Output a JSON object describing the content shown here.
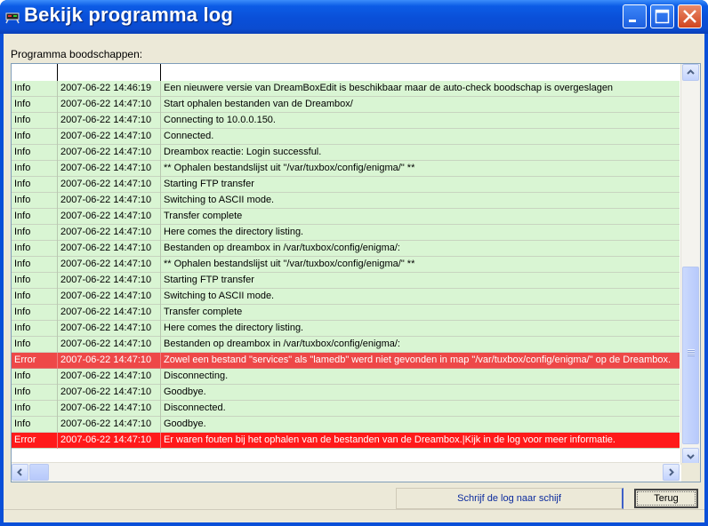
{
  "window": {
    "title": "Bekijk programma log"
  },
  "labels": {
    "messages": "Programma boodschappen:"
  },
  "log": {
    "rows": [
      {
        "type": "Info",
        "time": "2007-06-22 14:46:19",
        "message": "Een nieuwere versie van DreamBoxEdit is beschikbaar maar de auto-check boodschap is overgeslagen"
      },
      {
        "type": "Info",
        "time": "2007-06-22 14:47:10",
        "message": "Start ophalen bestanden van de Dreambox/"
      },
      {
        "type": "Info",
        "time": "2007-06-22 14:47:10",
        "message": "Connecting to 10.0.0.150."
      },
      {
        "type": "Info",
        "time": "2007-06-22 14:47:10",
        "message": "Connected."
      },
      {
        "type": "Info",
        "time": "2007-06-22 14:47:10",
        "message": "Dreambox reactie: Login successful."
      },
      {
        "type": "Info",
        "time": "2007-06-22 14:47:10",
        "message": "** Ophalen bestandslijst uit \"/var/tuxbox/config/enigma/\" **"
      },
      {
        "type": "Info",
        "time": "2007-06-22 14:47:10",
        "message": "Starting FTP transfer"
      },
      {
        "type": "Info",
        "time": "2007-06-22 14:47:10",
        "message": "Switching to ASCII mode."
      },
      {
        "type": "Info",
        "time": "2007-06-22 14:47:10",
        "message": "Transfer complete"
      },
      {
        "type": "Info",
        "time": "2007-06-22 14:47:10",
        "message": "Here comes the directory listing."
      },
      {
        "type": "Info",
        "time": "2007-06-22 14:47:10",
        "message": "Bestanden op dreambox in /var/tuxbox/config/enigma/:"
      },
      {
        "type": "Info",
        "time": "2007-06-22 14:47:10",
        "message": "** Ophalen bestandslijst uit \"/var/tuxbox/config/enigma/\" **"
      },
      {
        "type": "Info",
        "time": "2007-06-22 14:47:10",
        "message": "Starting FTP transfer"
      },
      {
        "type": "Info",
        "time": "2007-06-22 14:47:10",
        "message": "Switching to ASCII mode."
      },
      {
        "type": "Info",
        "time": "2007-06-22 14:47:10",
        "message": "Transfer complete"
      },
      {
        "type": "Info",
        "time": "2007-06-22 14:47:10",
        "message": "Here comes the directory listing."
      },
      {
        "type": "Info",
        "time": "2007-06-22 14:47:10",
        "message": "Bestanden op dreambox in /var/tuxbox/config/enigma/:"
      },
      {
        "type": "Error",
        "time": "2007-06-22 14:47:10",
        "message": "Zowel een bestand \"services\" als \"lamedb\" werd niet gevonden in map \"/var/tuxbox/config/enigma/\" op de Dreambox."
      },
      {
        "type": "Info",
        "time": "2007-06-22 14:47:10",
        "message": "Disconnecting."
      },
      {
        "type": "Info",
        "time": "2007-06-22 14:47:10",
        "message": "Goodbye."
      },
      {
        "type": "Info",
        "time": "2007-06-22 14:47:10",
        "message": "Disconnected."
      },
      {
        "type": "Info",
        "time": "2007-06-22 14:47:10",
        "message": "Goodbye."
      },
      {
        "type": "Error",
        "time": "2007-06-22 14:47:10",
        "message": "Er waren fouten bij het ophalen van de bestanden van de Dreambox.|Kijk in de log voor meer informatie."
      }
    ]
  },
  "buttons": {
    "save_log": "Schrijf de log naar schijf",
    "back": "Terug"
  },
  "icons": {
    "app": "dreambox-app-icon",
    "minimize": "minimize-icon",
    "maximize": "maximize-icon",
    "close": "close-icon"
  },
  "colors": {
    "info_row": "#d9f5d3",
    "error_row": "#ee4848",
    "error_row_last": "#ff1a1a",
    "titlebar": "#0a4fd8"
  }
}
